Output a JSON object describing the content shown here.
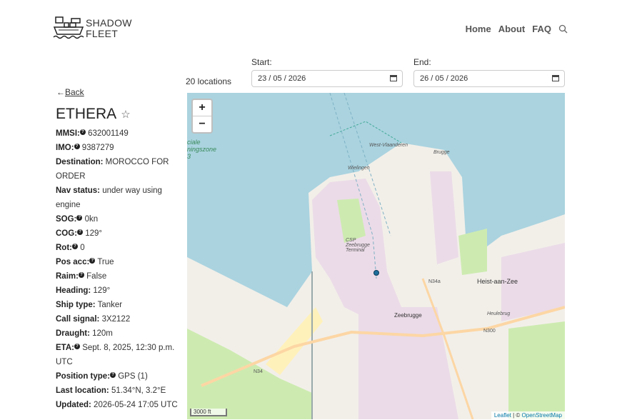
{
  "logo": {
    "line1": "SHADOW",
    "line2": "FLEET",
    "icon": "ship-icon"
  },
  "nav": {
    "home": "Home",
    "about": "About",
    "faq": "FAQ",
    "search_icon": "search-icon"
  },
  "filters": {
    "locations_count": "20 locations",
    "start_label": "Start:",
    "start_value": "23 / 05 / 2026",
    "end_label": "End:",
    "end_value": "26 / 05 / 2026"
  },
  "back": {
    "arrow": "←",
    "label": "Back"
  },
  "vessel": {
    "name": "ETHERA",
    "fields": [
      {
        "label": "MMSI:",
        "value": "632001149",
        "info": true
      },
      {
        "label": "IMO:",
        "value": "9387279",
        "info": true
      },
      {
        "label": "Destination:",
        "value": "MOROCCO FOR ORDER",
        "info": false
      },
      {
        "label": "Nav status:",
        "value": "under way using engine",
        "info": false
      },
      {
        "label": "SOG:",
        "value": "0kn",
        "info": true
      },
      {
        "label": "COG:",
        "value": "129°",
        "info": true
      },
      {
        "label": "Rot:",
        "value": "0",
        "info": true
      },
      {
        "label": "Pos acc:",
        "value": "True",
        "info": true
      },
      {
        "label": "Raim:",
        "value": "False",
        "info": true
      },
      {
        "label": "Heading:",
        "value": "129°",
        "info": false
      },
      {
        "label": "Ship type:",
        "value": "Tanker",
        "info": false
      },
      {
        "label": "Call signal:",
        "value": "3X2122",
        "info": false
      },
      {
        "label": "Draught:",
        "value": "120m",
        "info": false
      },
      {
        "label": "ETA:",
        "value": "Sept. 8, 2025, 12:30 p.m. UTC",
        "info": true
      },
      {
        "label": "Position type:",
        "value": "GPS (1)",
        "info": true
      },
      {
        "label": "Last location:",
        "value": "51.34°N, 3.2°E",
        "info": false
      },
      {
        "label": "Updated:",
        "value": "2026-05-24 17:05 UTC",
        "info": false
      }
    ]
  },
  "map": {
    "zoom_in": "+",
    "zoom_out": "−",
    "scale": "3000 ft",
    "attribution_leaflet": "Leaflet",
    "attribution_sep": " | © ",
    "attribution_osm": "OpenStreetMap",
    "labels": {
      "heist": "Heist-aan-Zee",
      "zeebrugge": "Zeebrugge",
      "n34a": "N34a",
      "n34": "N34",
      "n300": "N300",
      "csp": "CSP Zeebrugge Terminal",
      "brugge": "Brugge",
      "wielingen": "Wielingen",
      "westhinder": "West-Vlaanderen",
      "speciale": "ciale ningszone 3",
      "heulebrug": "Heulebrug"
    },
    "colors": {
      "water": "#aad3df",
      "land": "#f2efe9",
      "industrial": "#ebdbe8",
      "green": "#cdebb0",
      "beach": "#fff1ba",
      "road": "#fcd6a4"
    }
  }
}
